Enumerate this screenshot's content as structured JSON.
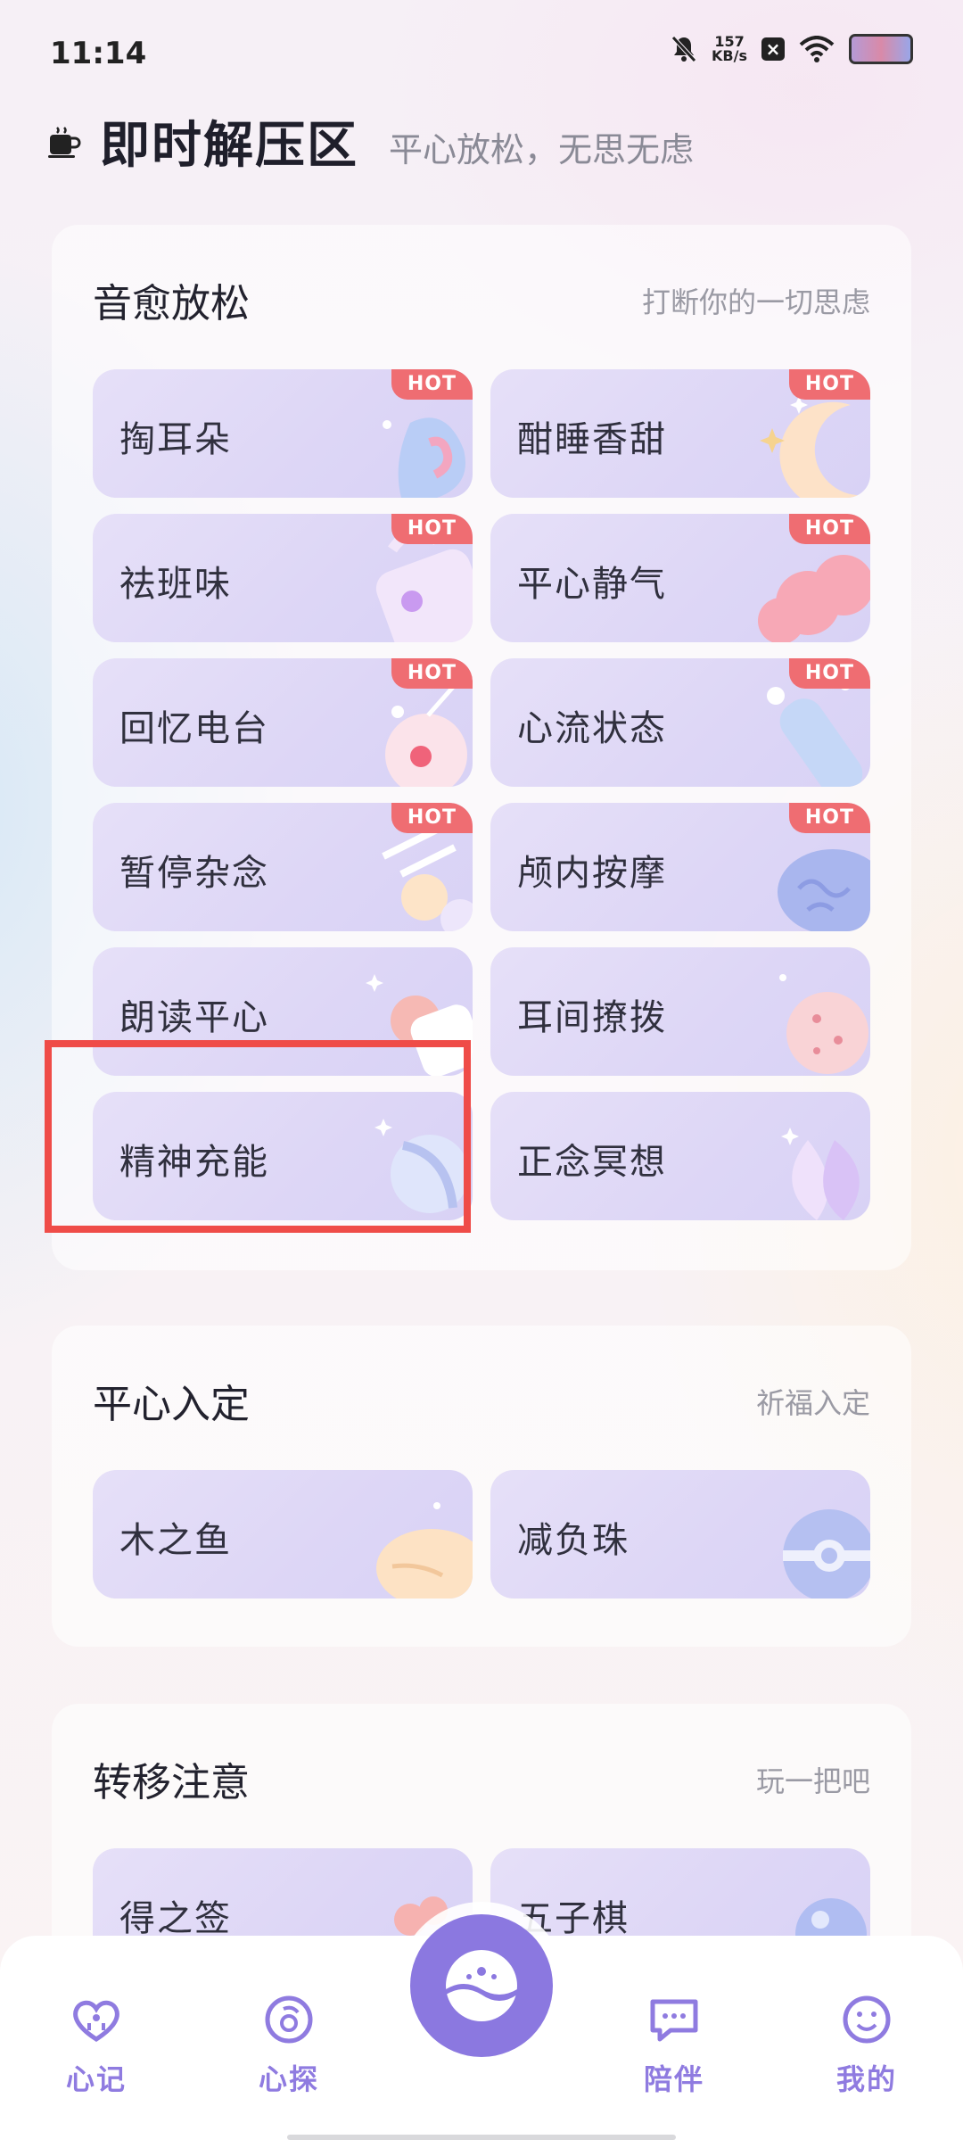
{
  "status_bar": {
    "time": "11:14",
    "net_speed_value": "157",
    "net_speed_unit": "KB/s"
  },
  "header": {
    "title": "即时解压区",
    "subtitle": "平心放松，无思无虑"
  },
  "sections": [
    {
      "title": "音愈放松",
      "subtitle": "打断你的一切思虑",
      "tiles": [
        {
          "label": "掏耳朵",
          "badge": "HOT",
          "icon": "ear-icon"
        },
        {
          "label": "酣睡香甜",
          "badge": "HOT",
          "icon": "moon-icon"
        },
        {
          "label": "祛班味",
          "badge": "HOT",
          "icon": "bag-icon"
        },
        {
          "label": "平心静气",
          "badge": "HOT",
          "icon": "cloud-icon"
        },
        {
          "label": "回忆电台",
          "badge": "HOT",
          "icon": "radio-icon"
        },
        {
          "label": "心流状态",
          "badge": "HOT",
          "icon": "flow-icon"
        },
        {
          "label": "暂停杂念",
          "badge": "HOT",
          "icon": "hourglass-icon"
        },
        {
          "label": "颅内按摩",
          "badge": "HOT",
          "icon": "brain-icon"
        },
        {
          "label": "朗读平心",
          "badge": "",
          "icon": "book-icon"
        },
        {
          "label": "耳间撩拨",
          "badge": "",
          "icon": "cookie-icon"
        },
        {
          "label": "精神充能",
          "badge": "",
          "icon": "ball-icon"
        },
        {
          "label": "正念冥想",
          "badge": "",
          "icon": "lotus-icon"
        }
      ]
    },
    {
      "title": "平心入定",
      "subtitle": "祈福入定",
      "tiles": [
        {
          "label": "木之鱼",
          "badge": "",
          "icon": "wooden-fish-icon"
        },
        {
          "label": "减负珠",
          "badge": "",
          "icon": "bead-icon"
        }
      ]
    },
    {
      "title": "转移注意",
      "subtitle": "玩一把吧",
      "tiles": [
        {
          "label": "得之签",
          "badge": "",
          "icon": "lot-icon"
        },
        {
          "label": "五子棋",
          "badge": "",
          "icon": "gomoku-icon"
        }
      ]
    }
  ],
  "nav": [
    {
      "label": "心记",
      "icon": "heart-icon"
    },
    {
      "label": "心探",
      "icon": "explore-icon"
    },
    {
      "label": "陪伴",
      "icon": "chat-icon"
    },
    {
      "label": "我的",
      "icon": "smile-icon"
    }
  ],
  "colors": {
    "accent": "#8b78e0",
    "hot_badge": "#ef6d72",
    "highlight": "#ef4c48",
    "tile_bg": "#ddd6f6"
  }
}
